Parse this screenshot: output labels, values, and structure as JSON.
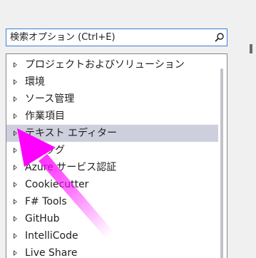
{
  "search": {
    "placeholder": "検索オプション (Ctrl+E)",
    "icon": "search-icon"
  },
  "tree": {
    "items": [
      {
        "label": "プロジェクトおよびソリューション",
        "selected": false
      },
      {
        "label": "環境",
        "selected": false
      },
      {
        "label": "ソース管理",
        "selected": false
      },
      {
        "label": "作業項目",
        "selected": false
      },
      {
        "label": "テキスト エディター",
        "selected": true
      },
      {
        "label": "デバッグ",
        "selected": false
      },
      {
        "label": "Azure サービス認証",
        "selected": false
      },
      {
        "label": "Cookiecutter",
        "selected": false
      },
      {
        "label": "F# Tools",
        "selected": false
      },
      {
        "label": "GitHub",
        "selected": false
      },
      {
        "label": "IntelliCode",
        "selected": false
      },
      {
        "label": "Live Share",
        "selected": false
      }
    ]
  },
  "annotation": {
    "arrow_color": "#ff00ff",
    "points_to": "テキスト エディター"
  },
  "colors": {
    "selection": "#cdd0dc",
    "focus_border": "#3b7fd6",
    "panel_border": "#828790"
  }
}
